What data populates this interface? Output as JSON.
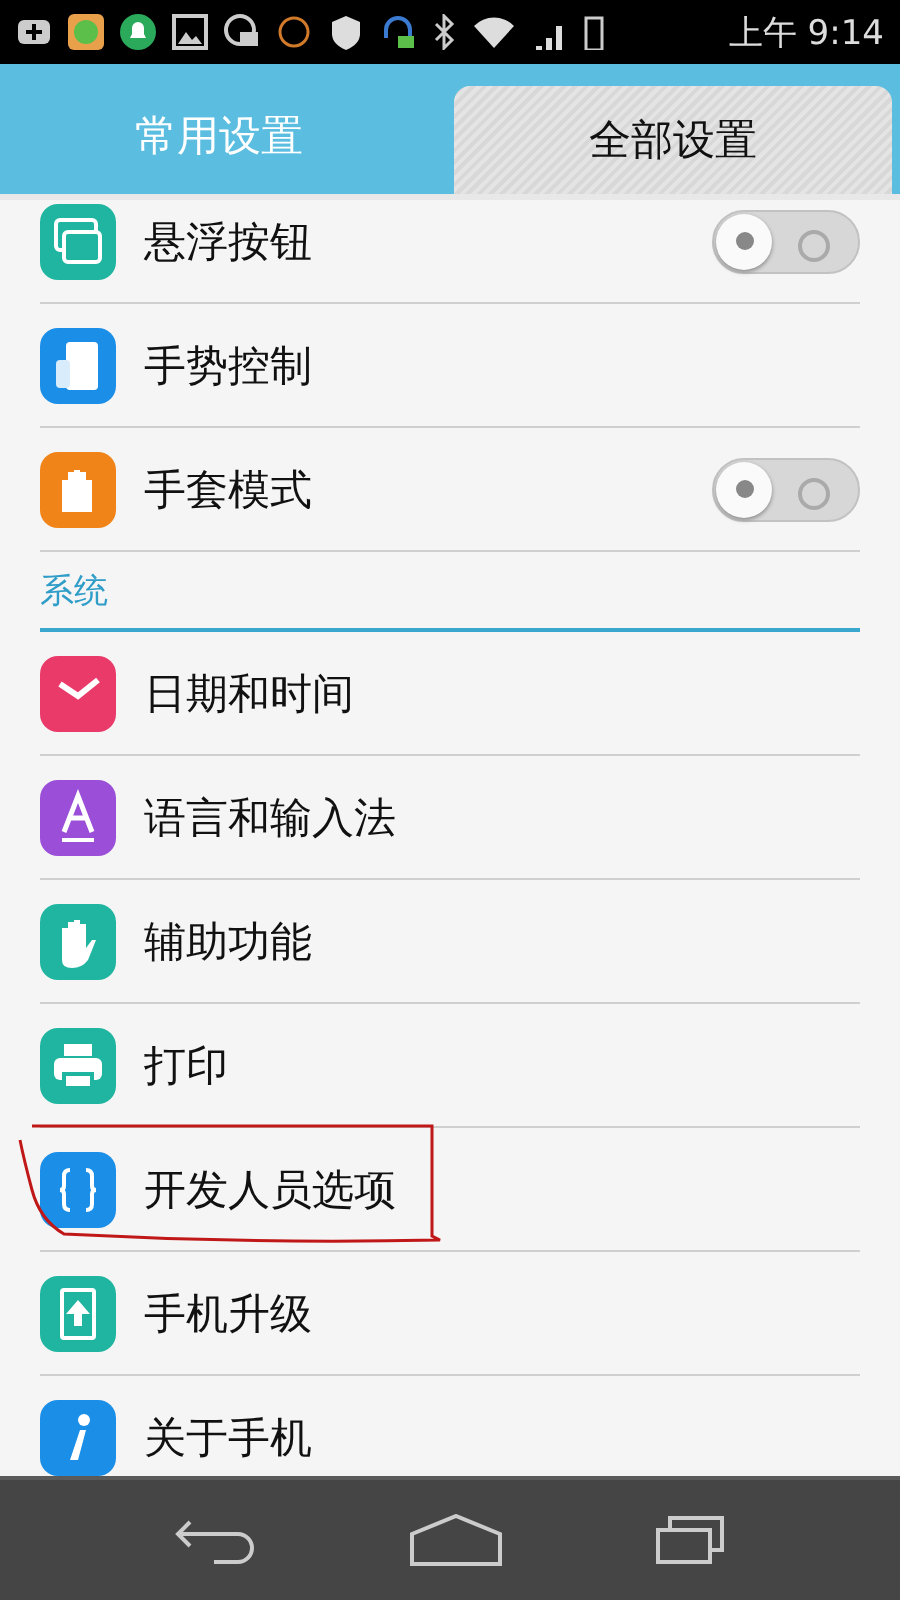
{
  "status_bar": {
    "time": "上午 9:14"
  },
  "tabs": [
    {
      "label": "常用设置",
      "selected": false
    },
    {
      "label": "全部设置",
      "selected": true
    }
  ],
  "sections": [
    {
      "items": [
        {
          "label": "悬浮按钮",
          "kind": "toggle",
          "on": false
        },
        {
          "label": "手势控制",
          "kind": "link"
        },
        {
          "label": "手套模式",
          "kind": "toggle",
          "on": false
        }
      ]
    },
    {
      "title": "系统",
      "items": [
        {
          "label": "日期和时间",
          "kind": "link"
        },
        {
          "label": "语言和输入法",
          "kind": "link"
        },
        {
          "label": "辅助功能",
          "kind": "link"
        },
        {
          "label": "打印",
          "kind": "link"
        },
        {
          "label": "开发人员选项",
          "kind": "link",
          "circled": true
        },
        {
          "label": "手机升级",
          "kind": "link"
        },
        {
          "label": "关于手机",
          "kind": "link"
        }
      ]
    }
  ]
}
